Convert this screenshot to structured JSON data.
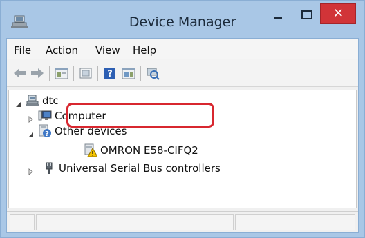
{
  "window": {
    "title": "Device Manager"
  },
  "menubar": {
    "items": [
      "File",
      "Action",
      "View",
      "Help"
    ]
  },
  "toolbar": {
    "buttons": [
      "back-icon",
      "forward-icon",
      "properties-icon",
      "update-driver-icon",
      "help-icon",
      "view-icon",
      "scan-hardware-icon"
    ]
  },
  "tree": {
    "root": {
      "label": "dtc",
      "icon": "computer-tree-icon"
    },
    "items": [
      {
        "label": "Computer",
        "icon": "monitor-icon",
        "expanded": false
      },
      {
        "label": "Other devices",
        "icon": "unknown-device-icon",
        "expanded": true
      },
      {
        "label": "OMRON E58-CIFQ2",
        "icon": "warning-device-icon"
      },
      {
        "label": "Universal Serial Bus controllers",
        "icon": "usb-plug-icon",
        "expanded": false
      }
    ]
  },
  "colors": {
    "titlebar": "#a9c7e6",
    "close": "#d13438",
    "highlight": "#d8272f"
  }
}
